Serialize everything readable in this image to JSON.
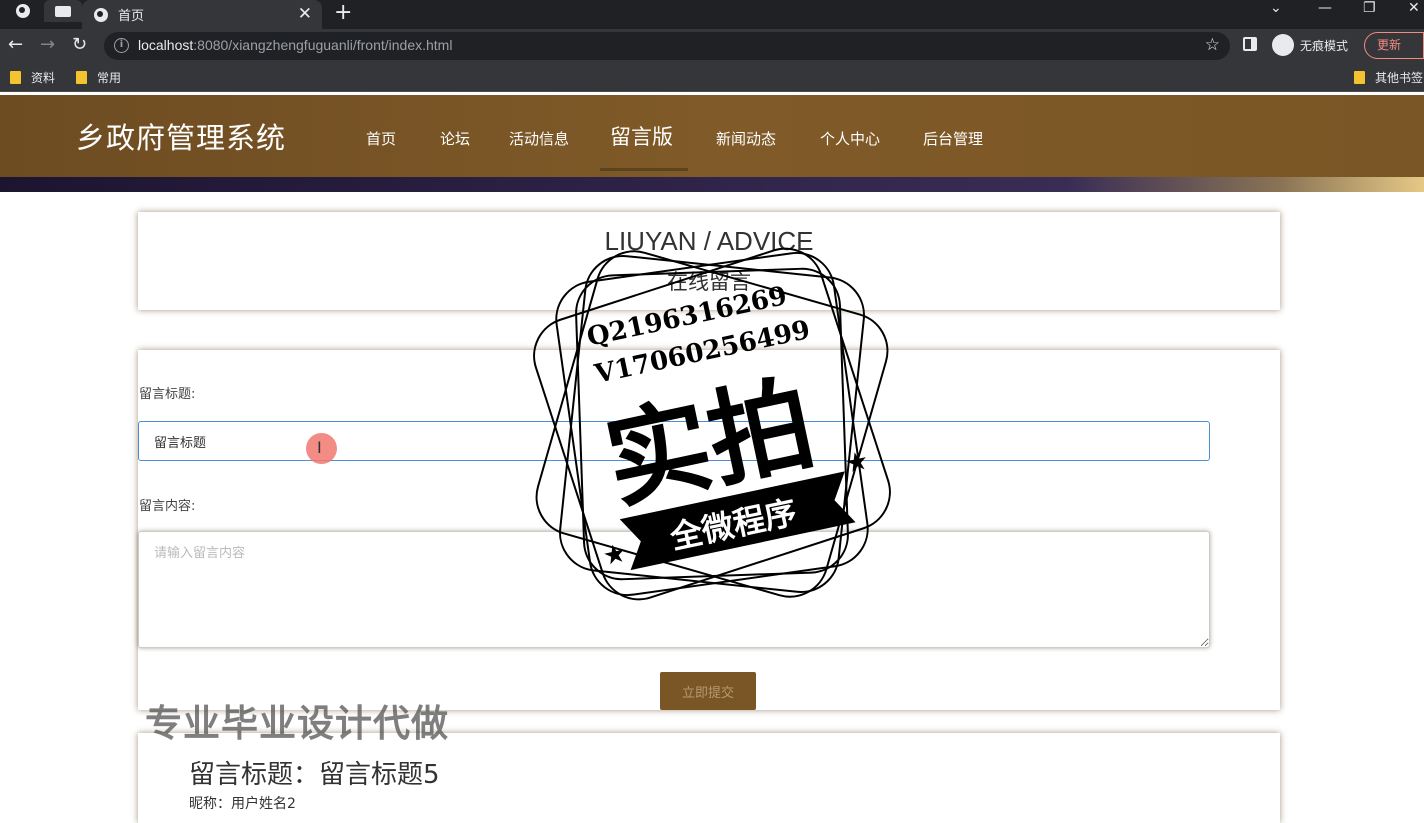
{
  "browser": {
    "tab_title": "首页",
    "url_host": "localhost",
    "url_rest": ":8080/xiangzhengfuguanli/front/index.html",
    "incognito_label": "无痕模式",
    "update_label": "更新",
    "bookmarks": [
      "资料",
      "常用"
    ],
    "other_bookmarks": "其他书签"
  },
  "site": {
    "logo": "乡政府管理系统",
    "nav": [
      {
        "label": "首页"
      },
      {
        "label": "论坛"
      },
      {
        "label": "活动信息"
      },
      {
        "label": "留言版"
      },
      {
        "label": "新闻动态"
      },
      {
        "label": "个人中心"
      },
      {
        "label": "后台管理"
      }
    ],
    "active_nav": "留言版"
  },
  "page_header": {
    "title": "LIUYAN / ADVICE",
    "subtitle": "在线留言"
  },
  "form": {
    "title_label": "留言标题:",
    "title_value": "留言标题",
    "content_label": "留言内容:",
    "content_placeholder": "请输入留言内容",
    "submit_label": "立即提交"
  },
  "message": {
    "title": "留言标题：留言标题5",
    "author": "昵称：用户姓名2"
  },
  "watermark": {
    "qq": "Q2196316269",
    "wechat": "V17060256499",
    "main": "实拍",
    "ribbon": "全微程序",
    "ad": "专业毕业设计代做"
  },
  "colors": {
    "header_brown": "#7a5626",
    "input_focus": "#4a90d9"
  }
}
